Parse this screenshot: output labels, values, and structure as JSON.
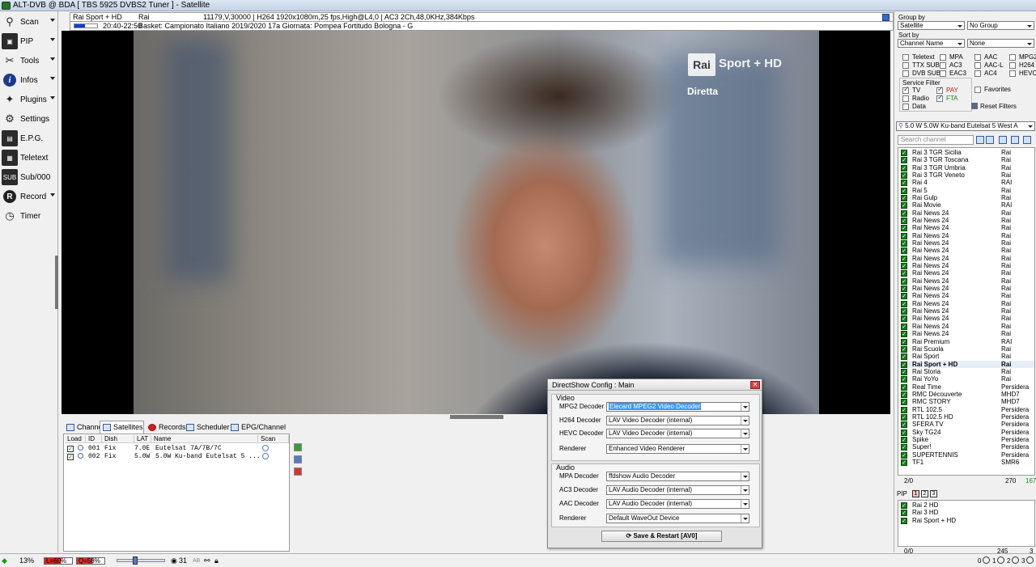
{
  "window": {
    "title": "ALT-DVB @ BDA [ TBS 5925 DVBS2 Tuner ] - Satellite"
  },
  "sidebar": {
    "items": [
      {
        "label": "Scan",
        "icon": "satellite-dish-icon",
        "glyph": "⚲",
        "has_menu": true
      },
      {
        "label": "PIP",
        "icon": "pip-icon",
        "glyph": "▣",
        "has_menu": true
      },
      {
        "label": "Tools",
        "icon": "tools-icon",
        "glyph": "✂",
        "has_menu": true
      },
      {
        "label": "Infos",
        "icon": "info-icon",
        "glyph": "i",
        "has_menu": true
      },
      {
        "label": "Plugins",
        "icon": "plugins-icon",
        "glyph": "✦",
        "has_menu": true
      },
      {
        "label": "Settings",
        "icon": "settings-gear-icon",
        "glyph": "⚙",
        "has_menu": false
      },
      {
        "label": "E.P.G.",
        "icon": "epg-icon",
        "glyph": "▤",
        "has_menu": false
      },
      {
        "label": "Teletext",
        "icon": "teletext-icon",
        "glyph": "▦",
        "has_menu": false
      },
      {
        "label": "Sub/000",
        "icon": "subtitles-icon",
        "glyph": "SUB",
        "has_menu": false
      },
      {
        "label": "Record",
        "icon": "record-icon",
        "glyph": "R",
        "has_menu": true
      },
      {
        "label": "Timer",
        "icon": "timer-icon",
        "glyph": "◷",
        "has_menu": false
      }
    ]
  },
  "info": {
    "channel": "Rai Sport + HD",
    "provider": "Rai",
    "stream": "11179,V,30000 | H264 1920x1080m,25 fps,High@L4,0 | AC3 2Ch,48,0KHz,384Kbps",
    "time": "20:40-22:50",
    "event": "Basket: Campionato Italiano 2019/2020 17a Giornata: Pompea Fortitudo Bologna - G",
    "progress": 0.45
  },
  "video": {
    "logo_rai": "Rai",
    "logo_sport": "Sport + HD",
    "overlay": "Diretta"
  },
  "tabs": [
    {
      "label": "Channel",
      "active": false
    },
    {
      "label": "Satellites",
      "active": true
    },
    {
      "label": "Records",
      "active": false
    },
    {
      "label": "Scheduler",
      "active": false
    },
    {
      "label": "EPG/Channel",
      "active": false
    }
  ],
  "satellites": {
    "columns": [
      "Load",
      "ID",
      "Dish",
      "LAT",
      "Name",
      "Scan"
    ],
    "rows": [
      {
        "id": "001",
        "dish": "Fix",
        "lat": "7.0E",
        "name": "Eutelsat 7A/7B/7C"
      },
      {
        "id": "002",
        "dish": "Fix",
        "lat": "5.0W",
        "name": "5.0W Ku-band Eutelsat 5 ..."
      }
    ]
  },
  "dialog": {
    "title": "DirectShow Config : Main",
    "video_group": "Video",
    "audio_group": "Audio",
    "video_fields": [
      {
        "label": "MPG2 Decoder",
        "value": "Elecard MPEG2 Video Decoder",
        "highlight": true
      },
      {
        "label": "H264 Decoder",
        "value": "LAV Video Decoder (internal)",
        "highlight": false
      },
      {
        "label": "HEVC Decoder",
        "value": "LAV Video Decoder (internal)",
        "highlight": false
      },
      {
        "label": "Renderer",
        "value": "Enhanced Video Renderer",
        "highlight": false
      }
    ],
    "audio_fields": [
      {
        "label": "MPA Decoder",
        "value": "ffdshow Audio Decoder"
      },
      {
        "label": "AC3 Decoder",
        "value": "LAV Audio Decoder (internal)"
      },
      {
        "label": "AAC Decoder",
        "value": "LAV Audio Decoder (internal)"
      },
      {
        "label": "Renderer",
        "value": "Default WaveOut Device"
      }
    ],
    "save_label": "Save & Restart [AV0]"
  },
  "right": {
    "group_by_label": "Group by",
    "group_by_value": "Satellite",
    "group_by_sub": "No Group",
    "sort_by_label": "Sort by",
    "sort_by_value": "Channel Name",
    "sort_by_sub": "None",
    "filters_col1": [
      "Teletext",
      "TTX SUB",
      "DVB SUB"
    ],
    "filters_col2": [
      "MPA",
      "AC3",
      "EAC3"
    ],
    "filters_col3": [
      "AAC",
      "AAC-L",
      "AC4"
    ],
    "filters_col4": [
      "MPG2",
      "H264",
      "HEVC"
    ],
    "service_filter_label": "Service Filter",
    "svc_tv": "TV",
    "svc_radio": "Radio",
    "svc_data": "Data",
    "svc_pay": "PAY",
    "svc_fta": "FTA",
    "favorites": "Favorites",
    "reset_filters": "Reset Filters",
    "satellite_select": "5.0 W 5.0W Ku-band Eutelsat 5 West A",
    "search_placeholder": "Search channel",
    "channels": [
      {
        "name": "Rai 3 TGR Sicilia",
        "provider": "Rai"
      },
      {
        "name": "Rai 3 TGR Toscana",
        "provider": "Rai"
      },
      {
        "name": "Rai 3 TGR Umbria",
        "provider": "Rai"
      },
      {
        "name": "Rai 3 TGR Veneto",
        "provider": "Rai"
      },
      {
        "name": "Rai 4",
        "provider": "RAI"
      },
      {
        "name": "Rai 5",
        "provider": "Rai"
      },
      {
        "name": "Rai Gulp",
        "provider": "Rai"
      },
      {
        "name": "Rai Movie",
        "provider": "RAI"
      },
      {
        "name": "Rai News 24",
        "provider": "Rai"
      },
      {
        "name": "Rai News 24",
        "provider": "Rai"
      },
      {
        "name": "Rai News 24",
        "provider": "Rai"
      },
      {
        "name": "Rai News 24",
        "provider": "Rai"
      },
      {
        "name": "Rai News 24",
        "provider": "Rai"
      },
      {
        "name": "Rai News 24",
        "provider": "Rai"
      },
      {
        "name": "Rai News 24",
        "provider": "Rai"
      },
      {
        "name": "Rai News 24",
        "provider": "Rai"
      },
      {
        "name": "Rai News 24",
        "provider": "Rai"
      },
      {
        "name": "Rai News 24",
        "provider": "Rai"
      },
      {
        "name": "Rai News 24",
        "provider": "Rai"
      },
      {
        "name": "Rai News 24",
        "provider": "Rai"
      },
      {
        "name": "Rai News 24",
        "provider": "Rai"
      },
      {
        "name": "Rai News 24",
        "provider": "Rai"
      },
      {
        "name": "Rai News 24",
        "provider": "Rai"
      },
      {
        "name": "Rai News 24",
        "provider": "Rai"
      },
      {
        "name": "Rai News 24",
        "provider": "Rai"
      },
      {
        "name": "Rai Premium",
        "provider": "RAI"
      },
      {
        "name": "Rai Scuola",
        "provider": "Rai"
      },
      {
        "name": "Rai Sport",
        "provider": "Rai"
      },
      {
        "name": "Rai Sport + HD",
        "provider": "Rai",
        "current": true
      },
      {
        "name": "Rai Storia",
        "provider": "Rai"
      },
      {
        "name": "Rai YoYo",
        "provider": "Rai"
      },
      {
        "name": "Real Time",
        "provider": "Persidera"
      },
      {
        "name": "RMC Découverte",
        "provider": "MHD7"
      },
      {
        "name": "RMC STORY",
        "provider": "MHD7"
      },
      {
        "name": "RTL 102.5",
        "provider": "Persidera"
      },
      {
        "name": "RTL 102.5 HD",
        "provider": "Persidera"
      },
      {
        "name": "SFERA TV",
        "provider": "Persidera"
      },
      {
        "name": "Sky TG24",
        "provider": "Persidera"
      },
      {
        "name": "Spike",
        "provider": "Persidera"
      },
      {
        "name": "Super!",
        "provider": "Persidera"
      },
      {
        "name": "SUPERTENNIS",
        "provider": "Persidera"
      },
      {
        "name": "TF1",
        "provider": "SMR6"
      }
    ],
    "list_pos": "2/0",
    "list_total": "270",
    "list_count": "167",
    "pip_label": "PIP",
    "pip_slots": [
      "1",
      "2",
      "3"
    ],
    "pip_channels": [
      "Rai 2 HD",
      "Rai 3 HD",
      "Rai Sport + HD"
    ],
    "pip_pos": "0/0",
    "pip_total": "245",
    "pip_count": "3"
  },
  "status": {
    "signal": "13%",
    "level_label": "L=60%",
    "quality_label": "Q=58%",
    "volume": 0.38,
    "volume_text": "31",
    "ab_label": "AB",
    "zoom_values": [
      "0",
      "1",
      "2",
      "3"
    ]
  },
  "colors": {
    "accent": "#1040c0",
    "tv_green": "#1e7a1e",
    "pay_red": "#c02020",
    "fta_green": "#1a8a1a",
    "signal_green": "#1a9a1a",
    "level_red": "#e02020",
    "quality_red": "#e03030"
  }
}
